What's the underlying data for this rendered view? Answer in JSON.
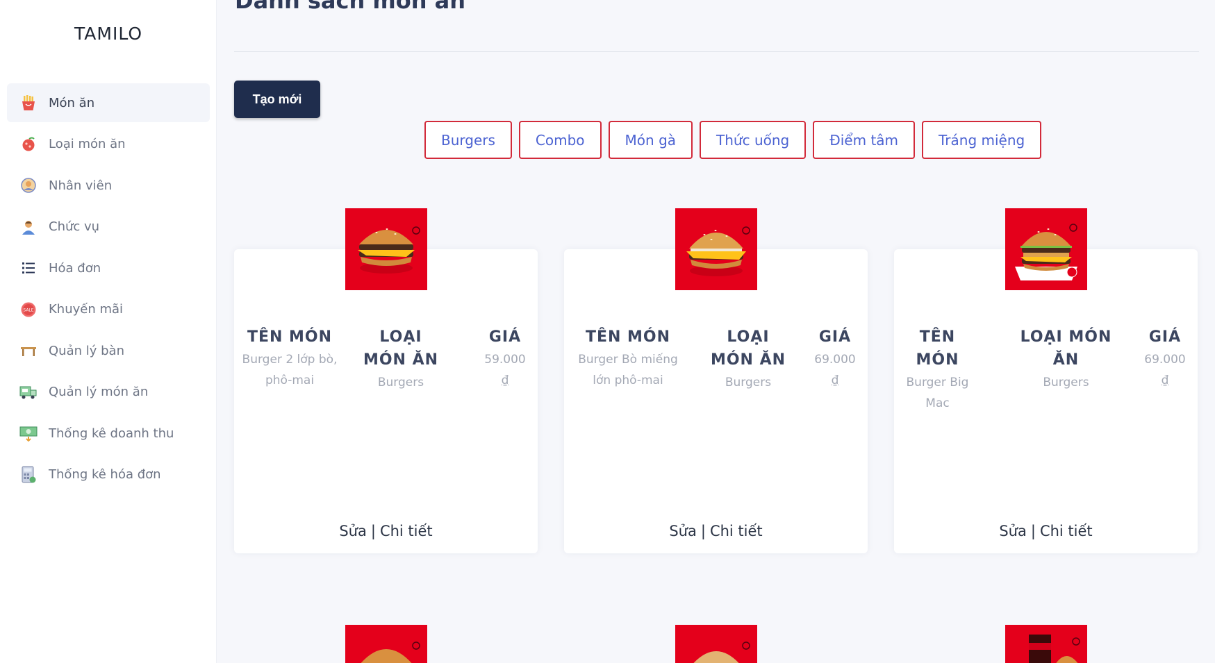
{
  "brand": "TAMILO",
  "sidebar": {
    "items": [
      {
        "label": "Món ăn",
        "icon": "fries-icon"
      },
      {
        "label": "Loại món ăn",
        "icon": "food-category-icon"
      },
      {
        "label": "Nhân viên",
        "icon": "staff-icon"
      },
      {
        "label": "Chức vụ",
        "icon": "position-icon"
      },
      {
        "label": "Hóa đơn",
        "icon": "invoice-list-icon"
      },
      {
        "label": "Khuyến mãi",
        "icon": "sale-badge-icon"
      },
      {
        "label": "Quản lý bàn",
        "icon": "table-icon"
      },
      {
        "label": "Quản lý món ăn",
        "icon": "food-truck-icon"
      },
      {
        "label": "Thống kê doanh thu",
        "icon": "revenue-stats-icon"
      },
      {
        "label": "Thống kê hóa đơn",
        "icon": "invoice-calculator-icon"
      }
    ]
  },
  "main": {
    "title": "Danh sách món ăn",
    "create_label": "Tạo mới",
    "filters": [
      "Burgers",
      "Combo",
      "Món gà",
      "Thức uống",
      "Điểm tâm",
      "Tráng miệng"
    ],
    "columns": {
      "name": "TÊN MÓN",
      "category": "LOẠI MÓN ĂN",
      "price": "GIÁ"
    },
    "cards": [
      {
        "name": "Burger 2 lớp bò, phô-mai",
        "category": "Burgers",
        "price": "59.000",
        "currency": "₫",
        "image": "double-cheeseburger-image"
      },
      {
        "name": "Burger Bò miếng lớn phô-mai",
        "category": "Burgers",
        "price": "69.000",
        "currency": "₫",
        "image": "quarter-pounder-image"
      },
      {
        "name": "Burger Big Mac",
        "category": "Burgers",
        "price": "69.000",
        "currency": "₫",
        "image": "big-mac-image"
      }
    ],
    "edit_label": "Sửa",
    "separator": "|",
    "detail_label": "Chi tiết"
  },
  "colors": {
    "sidebar_bg": "#ffffff",
    "page_bg": "#f6f7fb",
    "primary_button": "#1f2d4d",
    "filter_border": "#d22a3a",
    "filter_text": "#4c63d2",
    "product_bg": "#e4001b"
  }
}
